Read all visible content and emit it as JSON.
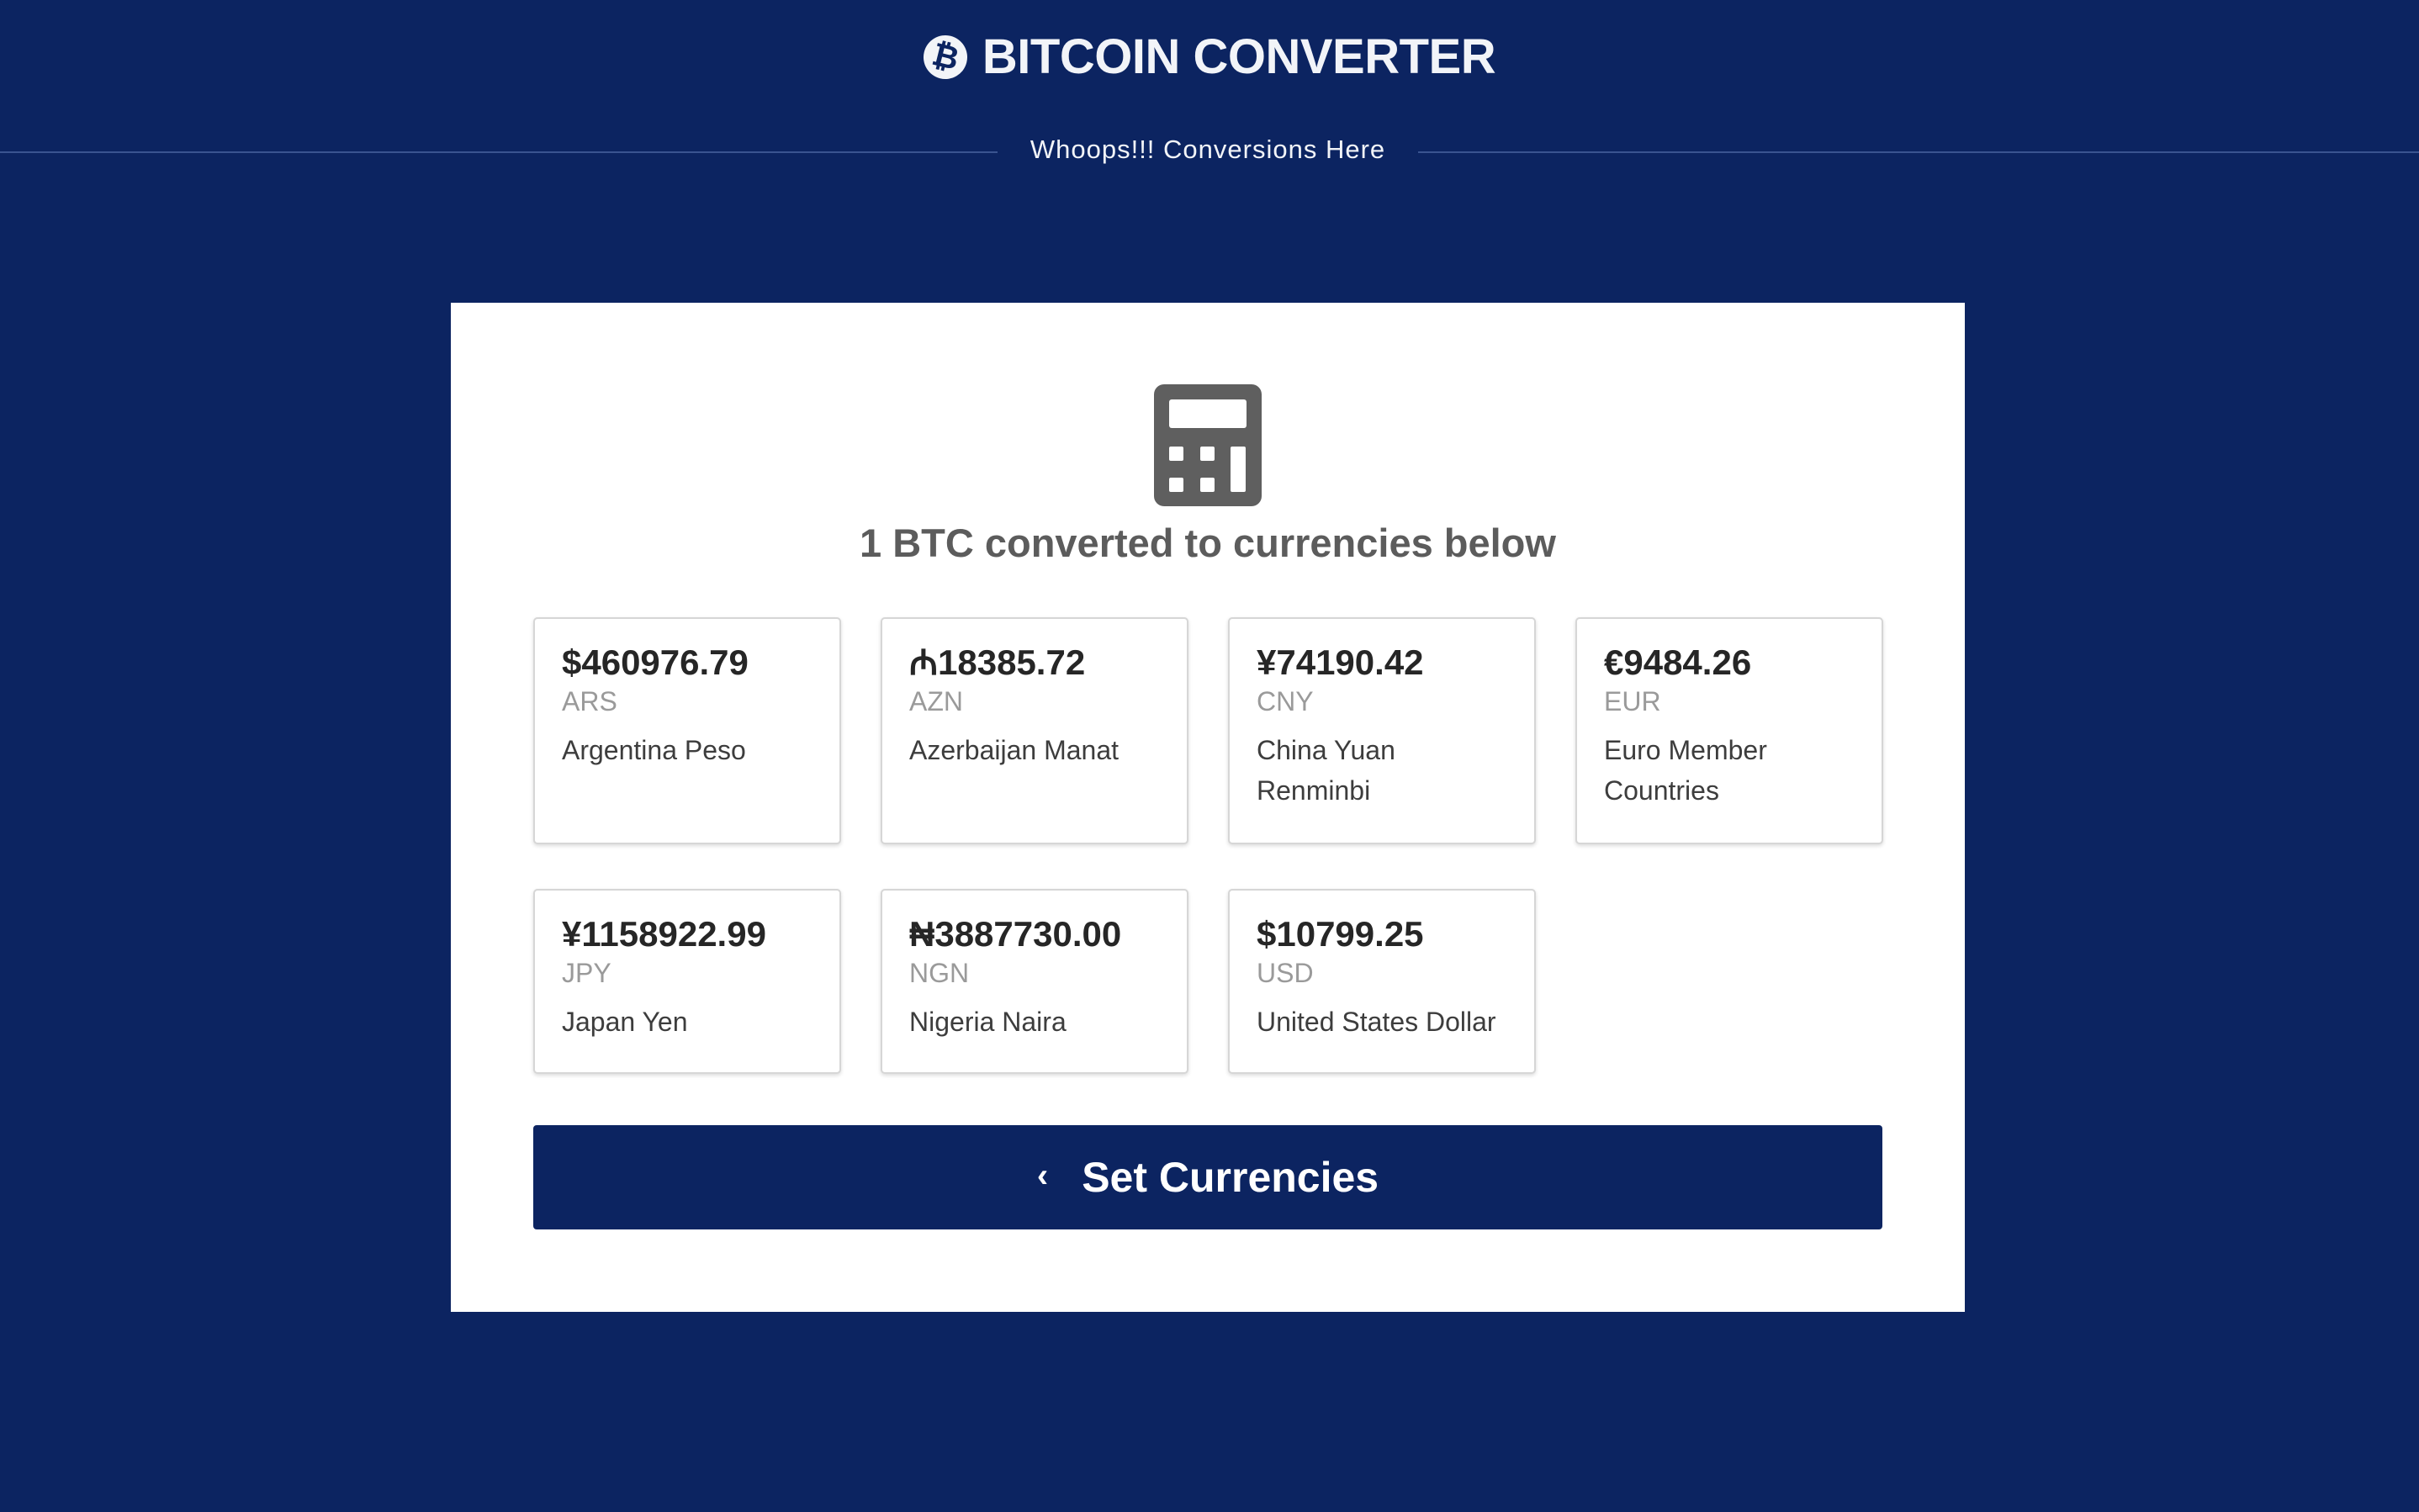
{
  "header": {
    "brand_icon": "bitcoin-icon",
    "title": "BITCOIN CONVERTER",
    "subtitle": "Whoops!!! Conversions Here"
  },
  "main": {
    "icon": "calculator-icon",
    "heading": "1 BTC converted to currencies below",
    "currencies": [
      {
        "amount": "$460976.79",
        "code": "ARS",
        "name": "Argentina Peso"
      },
      {
        "amount": "₼18385.72",
        "code": "AZN",
        "name": "Azerbaijan Manat"
      },
      {
        "amount": "¥74190.42",
        "code": "CNY",
        "name": "China Yuan Renminbi"
      },
      {
        "amount": "€9484.26",
        "code": "EUR",
        "name": "Euro Member Countries"
      },
      {
        "amount": "¥1158922.99",
        "code": "JPY",
        "name": "Japan Yen"
      },
      {
        "amount": "₦3887730.00",
        "code": "NGN",
        "name": "Nigeria Naira"
      },
      {
        "amount": "$10799.25",
        "code": "USD",
        "name": "United States Dollar"
      }
    ],
    "button": {
      "icon": "chevron-left-icon",
      "label": "Set Currencies"
    }
  },
  "colors": {
    "background": "#0c2461",
    "panel": "#ffffff",
    "button": "#0c2461",
    "heading_text": "#5c5c5c"
  }
}
